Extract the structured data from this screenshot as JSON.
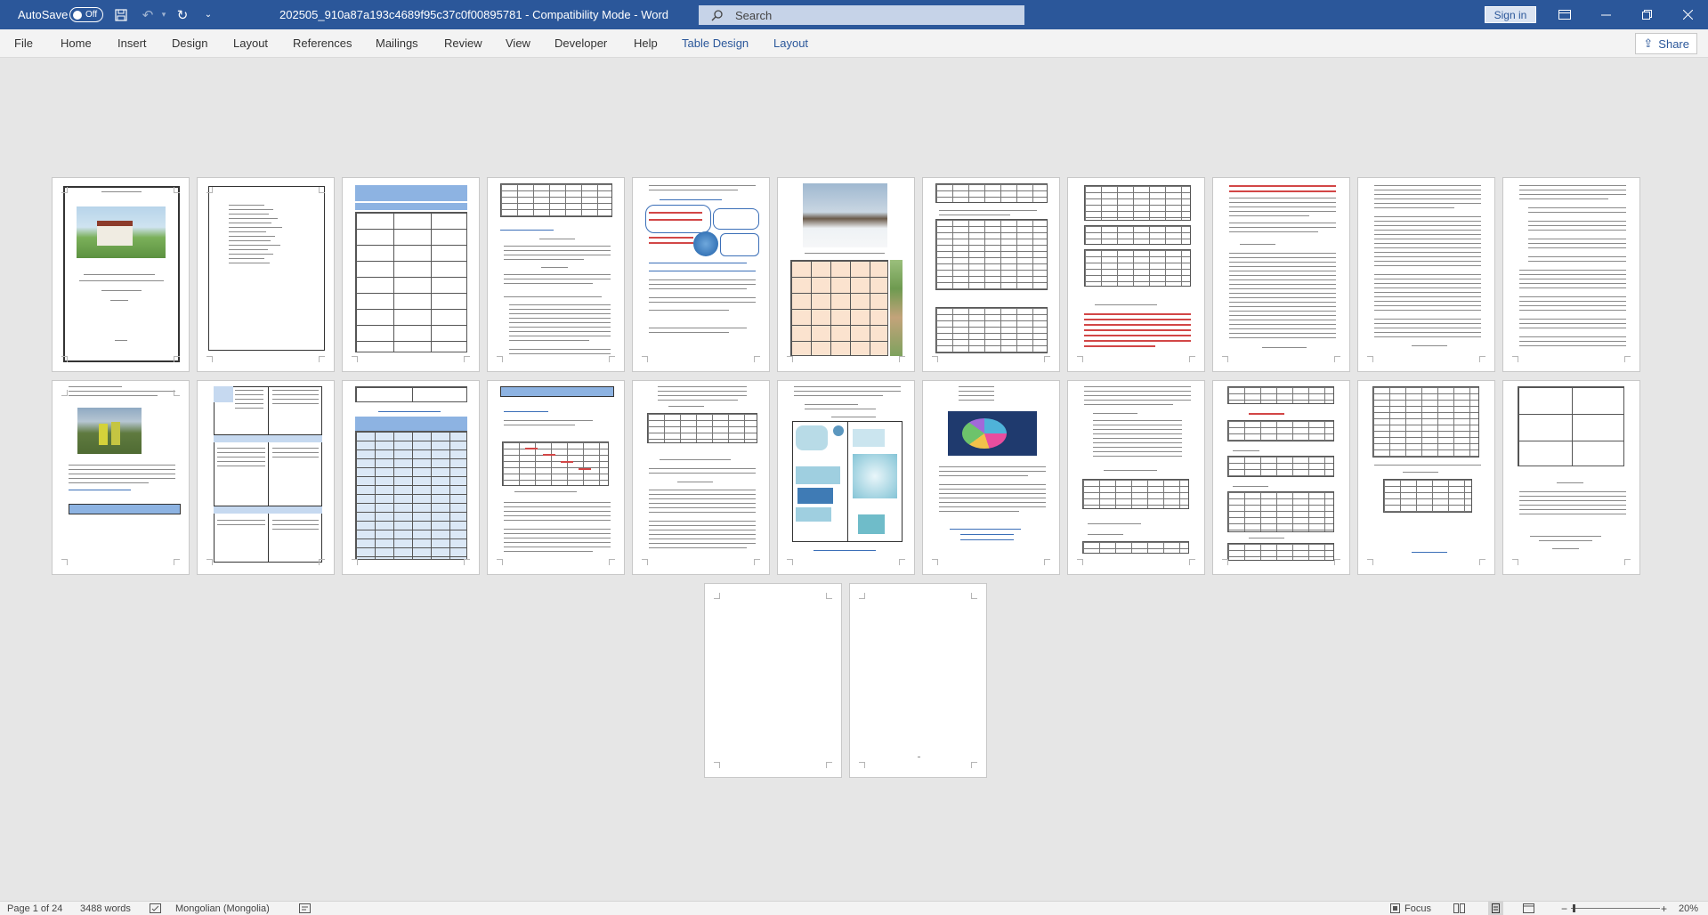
{
  "titlebar": {
    "autosave_label": "AutoSave",
    "autosave_state": "Off",
    "document_title": "202505_910a87a193c4689f95c37c0f00895781  -  Compatibility Mode  -  Word",
    "search_placeholder": "Search",
    "signin_label": "Sign in"
  },
  "ribbon": {
    "tabs": [
      "File",
      "Home",
      "Insert",
      "Design",
      "Layout",
      "References",
      "Mailings",
      "Review",
      "View",
      "Developer",
      "Help"
    ],
    "context_tabs": [
      "Table Design",
      "Layout"
    ],
    "share_label": "Share"
  },
  "status": {
    "page": "Page 1 of 24",
    "words": "3488 words",
    "language": "Mongolian (Mongolia)",
    "focus": "Focus",
    "zoom": "20%"
  },
  "colors": {
    "accent": "#2b579a",
    "canvas": "#e6e6e6",
    "table_header": "#8db3e2",
    "table_orange": "#f7c9a6"
  },
  "icons": [
    "save-icon",
    "undo-icon",
    "redo-icon",
    "customize-icon",
    "search-icon",
    "ribbon-display-icon",
    "minimize-icon",
    "restore-icon",
    "close-icon",
    "share-icon",
    "proofing-icon",
    "macro-icon",
    "read-mode-icon",
    "print-layout-icon",
    "web-layout-icon"
  ]
}
